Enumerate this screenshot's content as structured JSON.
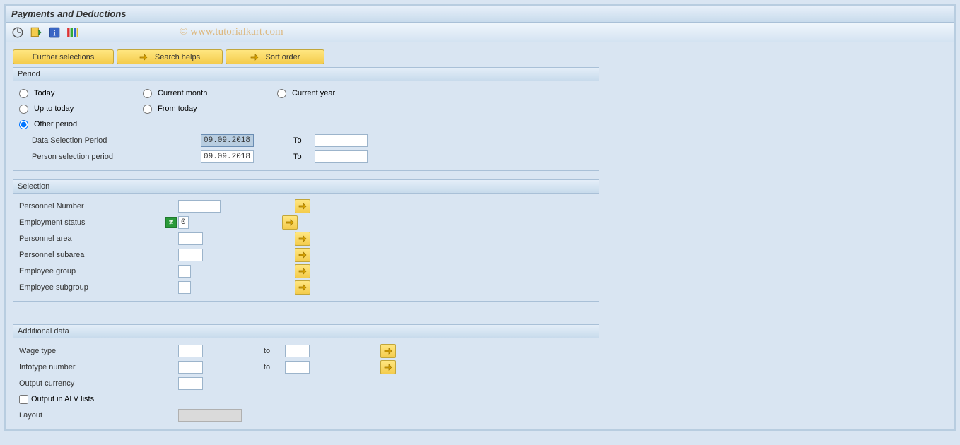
{
  "title": "Payments and Deductions",
  "watermark": "© www.tutorialkart.com",
  "toolbar": {
    "further_selections": "Further selections",
    "search_helps": "Search helps",
    "sort_order": "Sort order"
  },
  "period": {
    "title": "Period",
    "options": {
      "today": "Today",
      "current_month": "Current month",
      "current_year": "Current year",
      "up_to_today": "Up to today",
      "from_today": "From today",
      "other_period": "Other period"
    },
    "selected": "other_period",
    "data_selection_label": "Data Selection Period",
    "data_selection_from": "09.09.2018",
    "data_selection_to": "",
    "person_selection_label": "Person selection period",
    "person_selection_from": "09.09.2018",
    "person_selection_to": "",
    "to_label": "To"
  },
  "selection": {
    "title": "Selection",
    "fields": {
      "personnel_number": {
        "label": "Personnel Number",
        "value": ""
      },
      "employment_status": {
        "label": "Employment status",
        "value": "0",
        "indicator": "!="
      },
      "personnel_area": {
        "label": "Personnel area",
        "value": ""
      },
      "personnel_subarea": {
        "label": "Personnel subarea",
        "value": ""
      },
      "employee_group": {
        "label": "Employee group",
        "value": ""
      },
      "employee_subgroup": {
        "label": "Employee subgroup",
        "value": ""
      }
    }
  },
  "additional": {
    "title": "Additional data",
    "wage_type": {
      "label": "Wage type",
      "from": "",
      "to": ""
    },
    "infotype_number": {
      "label": "Infotype number",
      "from": "",
      "to": ""
    },
    "output_currency": {
      "label": "Output currency",
      "value": ""
    },
    "output_alv": {
      "label": "Output in ALV lists",
      "checked": false
    },
    "layout": {
      "label": "Layout",
      "value": ""
    },
    "to_label": "to"
  },
  "icons": {
    "execute": "execute-icon",
    "variant": "variant-icon",
    "info": "info-icon",
    "color": "color-legend-icon"
  }
}
